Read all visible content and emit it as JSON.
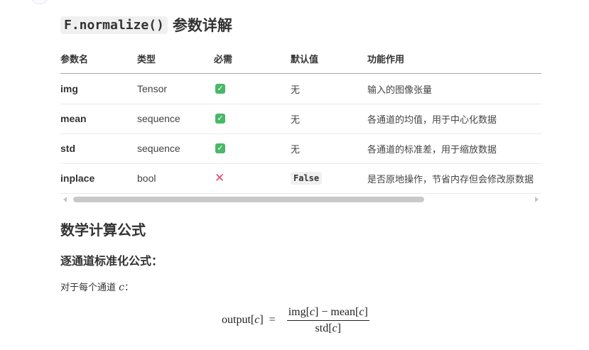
{
  "heading": {
    "code": "F.normalize()",
    "text": "参数详解"
  },
  "table": {
    "headers": [
      "参数名",
      "类型",
      "必需",
      "默认值",
      "功能作用"
    ],
    "rows": [
      {
        "name": "img",
        "type": "Tensor",
        "required": "✓",
        "default": "无",
        "desc": "输入的图像张量"
      },
      {
        "name": "mean",
        "type": "sequence",
        "required": "✓",
        "default": "无",
        "desc": "各通道的均值，用于中心化数据"
      },
      {
        "name": "std",
        "type": "sequence",
        "required": "✓",
        "default": "无",
        "desc": "各通道的标准差，用于缩放数据"
      },
      {
        "name": "inplace",
        "type": "bool",
        "required": "✕",
        "default": "False",
        "desc": "是否原地操作，节省内存但会修改原数据"
      }
    ],
    "required_icons": {
      "yes": "check-mark-icon",
      "no": "cross-mark-icon"
    }
  },
  "section": {
    "title": "数学计算公式",
    "subtitle": "逐通道标准化公式：",
    "intro": "对于每个通道",
    "intro_var": "c",
    "intro_colon": "："
  },
  "formula": {
    "lhs_fn": "output",
    "lhs_arg_open": "[",
    "lhs_arg": "c",
    "lhs_arg_close": "]",
    "equals": "=",
    "num_a": "img",
    "num_a_open": "[",
    "num_a_arg": "c",
    "num_a_close": "]",
    "minus": "−",
    "num_b": "mean",
    "num_b_open": "[",
    "num_b_arg": "c",
    "num_b_close": "]",
    "den": "std",
    "den_open": "[",
    "den_arg": "c",
    "den_close": "]"
  },
  "colors": {
    "check": "#49b869",
    "cross": "#e64a6f",
    "scroll_thumb": "#c9c9c9"
  }
}
